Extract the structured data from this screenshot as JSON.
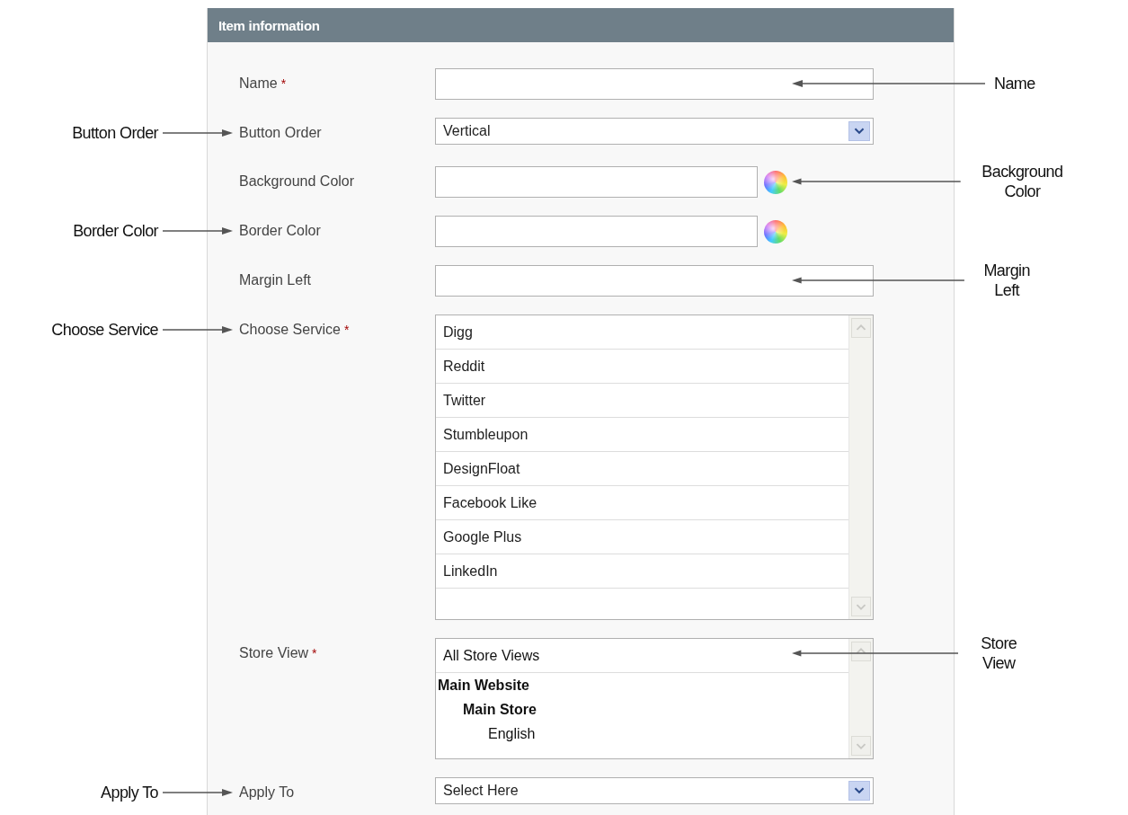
{
  "panel": {
    "title": "Item information"
  },
  "fields": [
    {
      "kind": "text",
      "label": "Name",
      "required_mark": "*",
      "right_callout": "Name"
    },
    {
      "kind": "select",
      "label": "Button Order",
      "value": "Vertical",
      "left_callout": "Button Order"
    },
    {
      "kind": "color",
      "label": "Background Color",
      "right_callout": "Background Color"
    },
    {
      "kind": "color",
      "label": "Border Color",
      "left_callout": "Border Color"
    },
    {
      "kind": "text",
      "label": "Margin Left",
      "right_callout": "Margin Left"
    },
    {
      "kind": "list",
      "label": "Choose Service",
      "required_mark": "*",
      "left_callout": "Choose Service",
      "options": [
        {
          "label": "Digg"
        },
        {
          "label": "Reddit"
        },
        {
          "label": "Twitter"
        },
        {
          "label": "Stumbleupon"
        },
        {
          "label": "DesignFloat"
        },
        {
          "label": "Facebook Like"
        },
        {
          "label": "Google Plus"
        },
        {
          "label": "LinkedIn"
        }
      ]
    },
    {
      "kind": "tree",
      "label": "Store View",
      "required_mark": "*",
      "right_callout": "Store View",
      "options": [
        {
          "label": "All Store Views"
        },
        {
          "label": "Main Website",
          "children": [
            {
              "label": "Main Store",
              "children": [
                {
                  "label": "English"
                }
              ]
            }
          ]
        }
      ]
    },
    {
      "kind": "select",
      "label": "Apply To",
      "value": "Select Here",
      "left_callout": "Apply To"
    }
  ]
}
